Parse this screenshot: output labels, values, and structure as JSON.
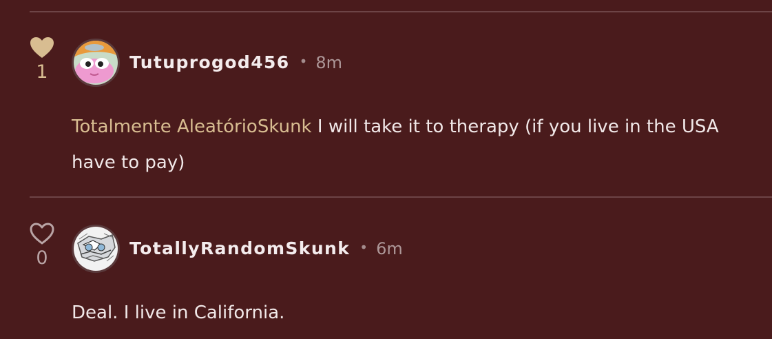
{
  "colors": {
    "background": "#4a1b1c",
    "divider": "#6d4446",
    "accent": "#d8bd91",
    "text": "#f1e8e8",
    "muted": "#ad9798"
  },
  "comments": [
    {
      "likes": "1",
      "liked": true,
      "like_icon": "heart-filled-icon",
      "avatar": "avatar-cartoon",
      "username": "Tutuprogod456",
      "separator": "•",
      "time": "8m",
      "mention": "Totalmente AleatórioSkunk",
      "text_line1": " I will take it to therapy (if you live in the USA",
      "text_line2": "have to pay)"
    },
    {
      "likes": "0",
      "liked": false,
      "like_icon": "heart-outline-icon",
      "avatar": "avatar-sketch",
      "username": "TotallyRandomSkunk",
      "separator": "•",
      "time": "6m",
      "text_line1": "Deal. I live in California."
    }
  ]
}
